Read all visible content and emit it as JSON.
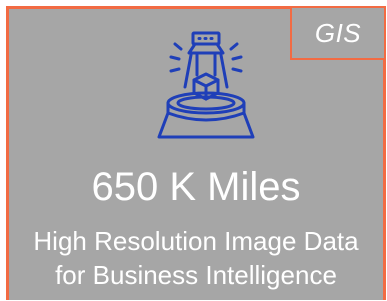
{
  "badge": {
    "label": "GIS"
  },
  "headline": {
    "value": "650 K Miles"
  },
  "description": {
    "line1": "High Resolution Image Data",
    "line2": "for Business Intelligence"
  },
  "colors": {
    "background": "#a6a6a6",
    "border": "#f26b43",
    "icon": "#1f3fb8",
    "text": "#ffffff"
  },
  "icon": {
    "name": "scanner-3d-icon"
  }
}
